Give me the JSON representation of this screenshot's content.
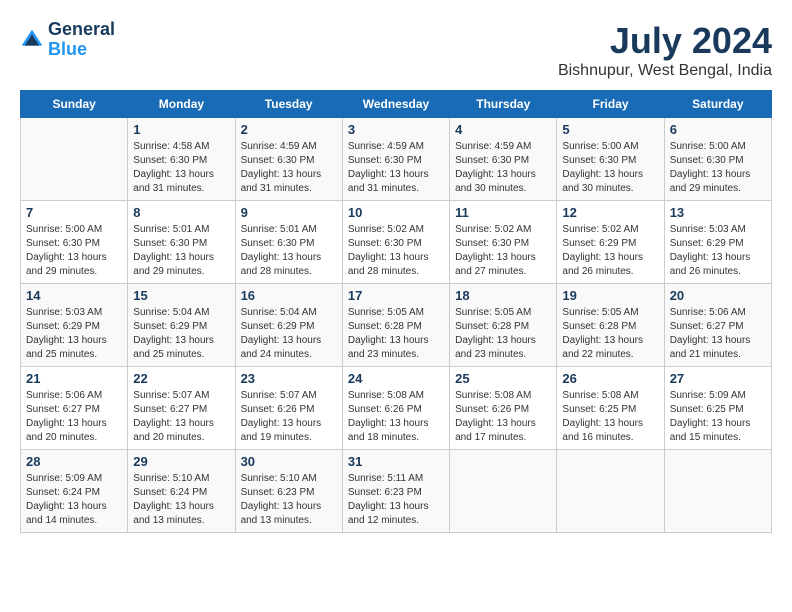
{
  "logo": {
    "line1": "General",
    "line2": "Blue"
  },
  "title": {
    "month_year": "July 2024",
    "location": "Bishnupur, West Bengal, India"
  },
  "headers": [
    "Sunday",
    "Monday",
    "Tuesday",
    "Wednesday",
    "Thursday",
    "Friday",
    "Saturday"
  ],
  "weeks": [
    [
      {
        "day": "",
        "info": ""
      },
      {
        "day": "1",
        "info": "Sunrise: 4:58 AM\nSunset: 6:30 PM\nDaylight: 13 hours\nand 31 minutes."
      },
      {
        "day": "2",
        "info": "Sunrise: 4:59 AM\nSunset: 6:30 PM\nDaylight: 13 hours\nand 31 minutes."
      },
      {
        "day": "3",
        "info": "Sunrise: 4:59 AM\nSunset: 6:30 PM\nDaylight: 13 hours\nand 31 minutes."
      },
      {
        "day": "4",
        "info": "Sunrise: 4:59 AM\nSunset: 6:30 PM\nDaylight: 13 hours\nand 30 minutes."
      },
      {
        "day": "5",
        "info": "Sunrise: 5:00 AM\nSunset: 6:30 PM\nDaylight: 13 hours\nand 30 minutes."
      },
      {
        "day": "6",
        "info": "Sunrise: 5:00 AM\nSunset: 6:30 PM\nDaylight: 13 hours\nand 29 minutes."
      }
    ],
    [
      {
        "day": "7",
        "info": "Sunrise: 5:00 AM\nSunset: 6:30 PM\nDaylight: 13 hours\nand 29 minutes."
      },
      {
        "day": "8",
        "info": "Sunrise: 5:01 AM\nSunset: 6:30 PM\nDaylight: 13 hours\nand 29 minutes."
      },
      {
        "day": "9",
        "info": "Sunrise: 5:01 AM\nSunset: 6:30 PM\nDaylight: 13 hours\nand 28 minutes."
      },
      {
        "day": "10",
        "info": "Sunrise: 5:02 AM\nSunset: 6:30 PM\nDaylight: 13 hours\nand 28 minutes."
      },
      {
        "day": "11",
        "info": "Sunrise: 5:02 AM\nSunset: 6:30 PM\nDaylight: 13 hours\nand 27 minutes."
      },
      {
        "day": "12",
        "info": "Sunrise: 5:02 AM\nSunset: 6:29 PM\nDaylight: 13 hours\nand 26 minutes."
      },
      {
        "day": "13",
        "info": "Sunrise: 5:03 AM\nSunset: 6:29 PM\nDaylight: 13 hours\nand 26 minutes."
      }
    ],
    [
      {
        "day": "14",
        "info": "Sunrise: 5:03 AM\nSunset: 6:29 PM\nDaylight: 13 hours\nand 25 minutes."
      },
      {
        "day": "15",
        "info": "Sunrise: 5:04 AM\nSunset: 6:29 PM\nDaylight: 13 hours\nand 25 minutes."
      },
      {
        "day": "16",
        "info": "Sunrise: 5:04 AM\nSunset: 6:29 PM\nDaylight: 13 hours\nand 24 minutes."
      },
      {
        "day": "17",
        "info": "Sunrise: 5:05 AM\nSunset: 6:28 PM\nDaylight: 13 hours\nand 23 minutes."
      },
      {
        "day": "18",
        "info": "Sunrise: 5:05 AM\nSunset: 6:28 PM\nDaylight: 13 hours\nand 23 minutes."
      },
      {
        "day": "19",
        "info": "Sunrise: 5:05 AM\nSunset: 6:28 PM\nDaylight: 13 hours\nand 22 minutes."
      },
      {
        "day": "20",
        "info": "Sunrise: 5:06 AM\nSunset: 6:27 PM\nDaylight: 13 hours\nand 21 minutes."
      }
    ],
    [
      {
        "day": "21",
        "info": "Sunrise: 5:06 AM\nSunset: 6:27 PM\nDaylight: 13 hours\nand 20 minutes."
      },
      {
        "day": "22",
        "info": "Sunrise: 5:07 AM\nSunset: 6:27 PM\nDaylight: 13 hours\nand 20 minutes."
      },
      {
        "day": "23",
        "info": "Sunrise: 5:07 AM\nSunset: 6:26 PM\nDaylight: 13 hours\nand 19 minutes."
      },
      {
        "day": "24",
        "info": "Sunrise: 5:08 AM\nSunset: 6:26 PM\nDaylight: 13 hours\nand 18 minutes."
      },
      {
        "day": "25",
        "info": "Sunrise: 5:08 AM\nSunset: 6:26 PM\nDaylight: 13 hours\nand 17 minutes."
      },
      {
        "day": "26",
        "info": "Sunrise: 5:08 AM\nSunset: 6:25 PM\nDaylight: 13 hours\nand 16 minutes."
      },
      {
        "day": "27",
        "info": "Sunrise: 5:09 AM\nSunset: 6:25 PM\nDaylight: 13 hours\nand 15 minutes."
      }
    ],
    [
      {
        "day": "28",
        "info": "Sunrise: 5:09 AM\nSunset: 6:24 PM\nDaylight: 13 hours\nand 14 minutes."
      },
      {
        "day": "29",
        "info": "Sunrise: 5:10 AM\nSunset: 6:24 PM\nDaylight: 13 hours\nand 13 minutes."
      },
      {
        "day": "30",
        "info": "Sunrise: 5:10 AM\nSunset: 6:23 PM\nDaylight: 13 hours\nand 13 minutes."
      },
      {
        "day": "31",
        "info": "Sunrise: 5:11 AM\nSunset: 6:23 PM\nDaylight: 13 hours\nand 12 minutes."
      },
      {
        "day": "",
        "info": ""
      },
      {
        "day": "",
        "info": ""
      },
      {
        "day": "",
        "info": ""
      }
    ]
  ]
}
